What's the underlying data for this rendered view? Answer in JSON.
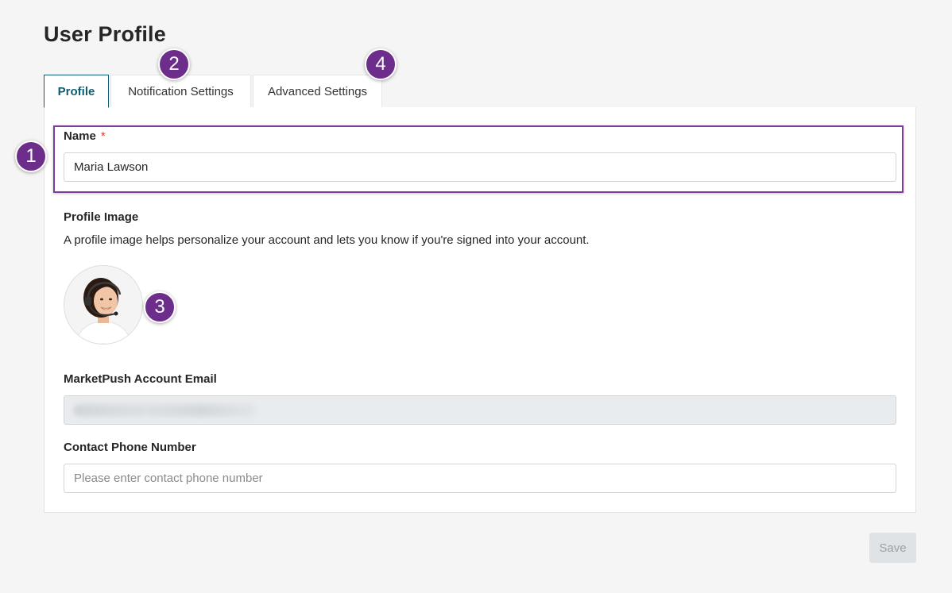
{
  "page": {
    "title": "User Profile"
  },
  "tabs": [
    {
      "label": "Profile",
      "active": true
    },
    {
      "label": "Notification Settings",
      "active": false
    },
    {
      "label": "Advanced Settings",
      "active": false
    }
  ],
  "form": {
    "name": {
      "label": "Name",
      "required_mark": "*",
      "value": "Maria Lawson"
    },
    "profile_image": {
      "label": "Profile Image",
      "help_text": "A profile image helps personalize your account and lets you know if you're signed into your account."
    },
    "email": {
      "label": "MarketPush Account Email"
    },
    "phone": {
      "label": "Contact Phone Number",
      "value": "",
      "placeholder": "Please enter contact phone number"
    }
  },
  "annotations": [
    "1",
    "2",
    "3",
    "4"
  ],
  "actions": {
    "save_label": "Save"
  },
  "colors": {
    "accent": "#0f5d73",
    "badge": "#6c2e8a",
    "required": "#e53935",
    "highlight_border": "#7b3f98"
  }
}
